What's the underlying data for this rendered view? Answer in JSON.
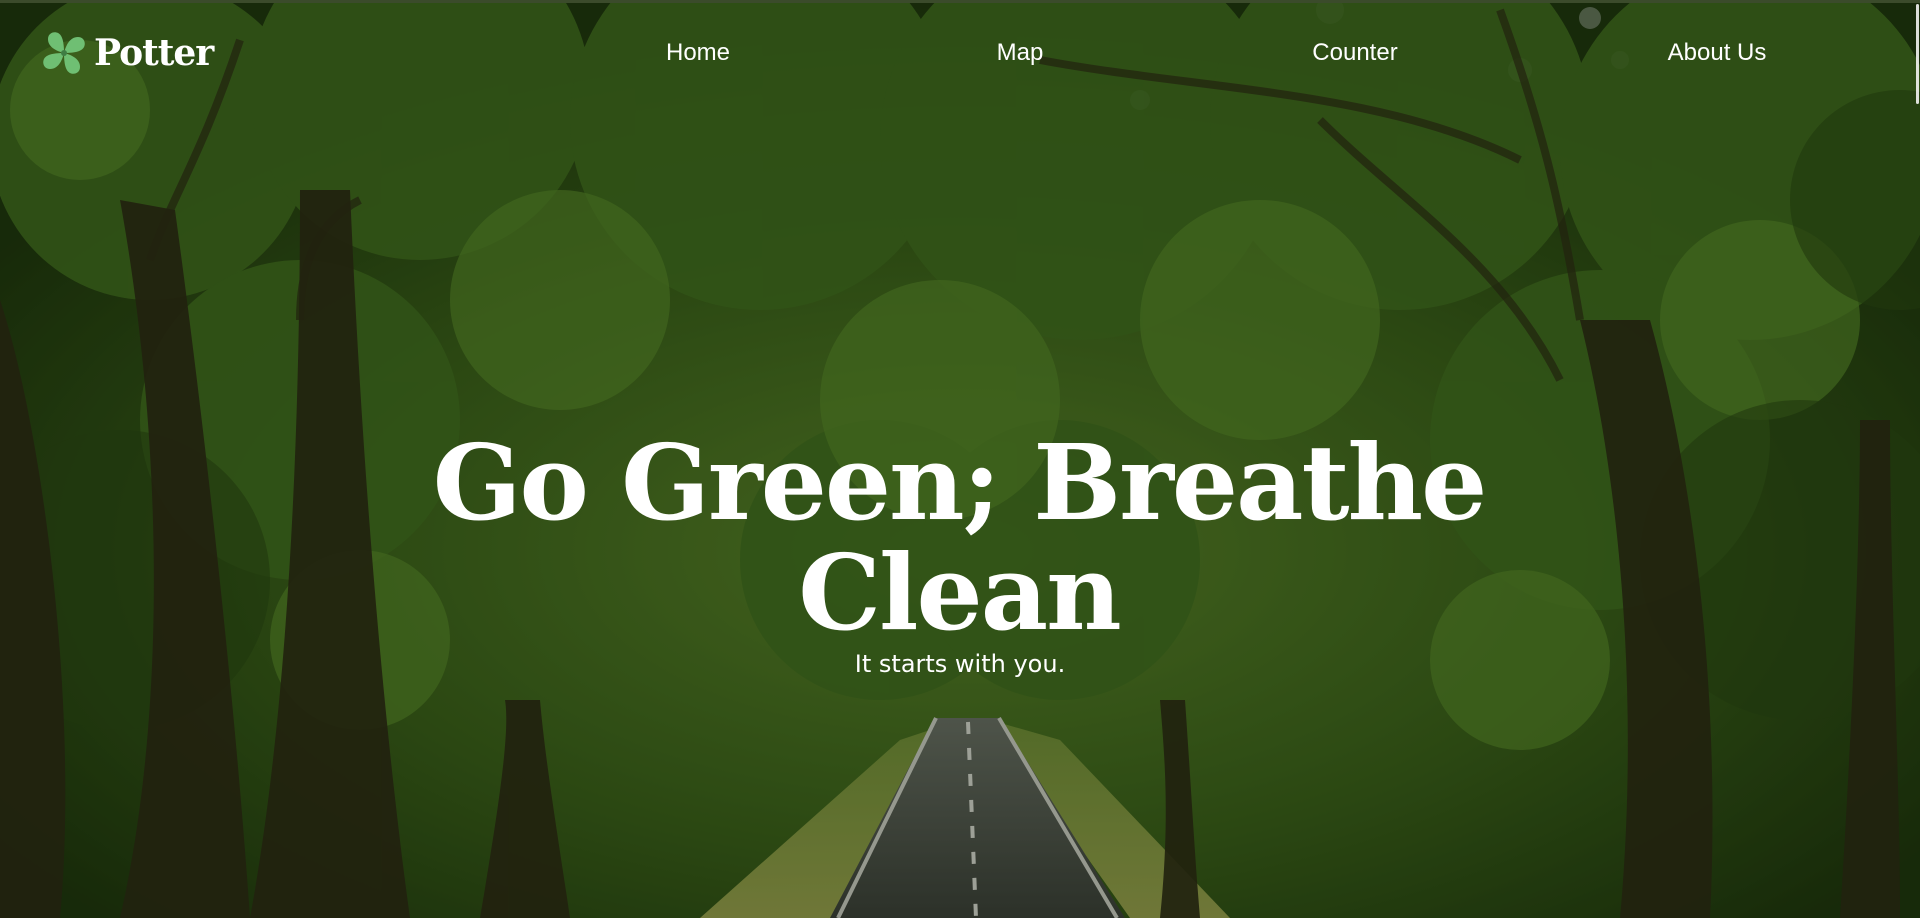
{
  "brand": {
    "name": "Potter",
    "logo_icon": "clover-leaf-icon",
    "logo_color": "#6fbf73"
  },
  "nav": {
    "items": [
      {
        "label": "Home"
      },
      {
        "label": "Map"
      },
      {
        "label": "Counter"
      },
      {
        "label": "About Us"
      }
    ]
  },
  "hero": {
    "headline": "Go Green; Breathe Clean",
    "tagline": "It starts with you.",
    "background": "tree-lined-road-photo",
    "text_color": "#ffffff",
    "foliage_color": "#3f6a1f"
  }
}
